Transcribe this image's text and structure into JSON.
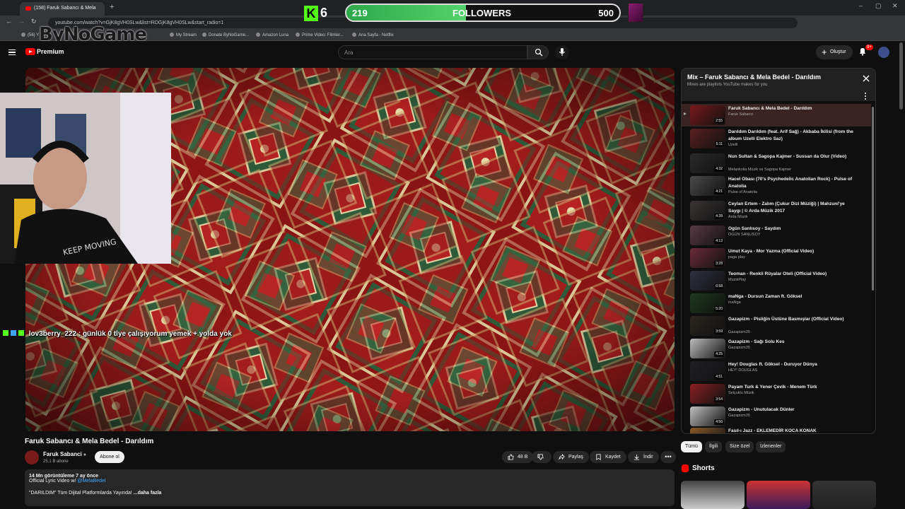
{
  "browser": {
    "tab_title": "(158) Faruk Sabancı & Mela",
    "url": "youtube.com/watch?v=GjK8gVH0SLw&list=RDGjK8gVH0SLw&start_radio=1",
    "bookmarks": [
      "(56) Y",
      "My Stream",
      "Donate ByNoGame...",
      "Amazon Luna",
      "Prime Video: Filmler...",
      "Ana Sayfa - Netflix"
    ]
  },
  "overlay": {
    "logo_text": "ByNoGame",
    "kick_count": "6",
    "followers_current": "219",
    "followers_label": "FOLLOWERS",
    "followers_goal": "500",
    "followers_progress": 0.438,
    "chat_message": "lov3berry_222 : günlük 0 tlye çalışıyorum yemek + yolda yok"
  },
  "header": {
    "premium_label": "Premium",
    "search_placeholder": "Ara",
    "create_label": "Oluştur",
    "notification_count": "9+"
  },
  "video": {
    "title": "Faruk Sabancı & Mela Bedel - Darıldım",
    "channel": "Faruk Sabanci",
    "subscribers": "25,1 B abone",
    "subscribe_label": "Abone ol",
    "likes": "48 B",
    "share_label": "Paylaş",
    "save_label": "Kaydet",
    "download_label": "İndir",
    "views_line": "14 Mn görüntüleme  7 ay önce",
    "desc_line1_prefix": "Official Lyric Video w/ ",
    "desc_link": "@MelaBedel",
    "desc_line3": "\"DARILDIM\" Tüm Dijital Platformlarda Yayında!",
    "more_label": "...daha fazla"
  },
  "playlist": {
    "title": "Mix – Faruk Sabancı & Mela Bedel - Darıldım",
    "subtitle": "Mixes are playlists YouTube makes for you",
    "items": [
      {
        "title": "Faruk Sabancı & Mela Bedel - Darıldım",
        "channel": "Faruk Sabanci",
        "duration": "2:55",
        "color": "#7a1a1a"
      },
      {
        "title": "Darıldım Darıldım (feat. Arif Sağ) - Akbaba İkilisi (from the album Uzelli Elektro Saz)",
        "channel": "Uzelli",
        "duration": "5:11",
        "color": "#5a2020"
      },
      {
        "title": "Nun Sultan & Sagopa Kajmer - Sussan da Olur (Video)",
        "channel": "Melankolia Müzik ve Sagopa Kajmer",
        "duration": "4:32",
        "color": "#2a2a2a"
      },
      {
        "title": "Hacel Obası (70's Psychedelic Anatolian Rock) - Pulse of Anatolia",
        "channel": "Pulse of Anatolia",
        "duration": "4:21",
        "color": "#4a4a4a"
      },
      {
        "title": "Ceylan Ertem - Zalım (Çukur Dizi Müziği) | Mahzuni'ye Saygı | © Arda Müzik 2017",
        "channel": "Arda Müzik",
        "duration": "4:28",
        "color": "#3a3535"
      },
      {
        "title": "Ogün Sanlısoy - Saydım",
        "channel": "OGÜN SANLISOY",
        "duration": "4:13",
        "color": "#5a3a45"
      },
      {
        "title": "Umut Kaya - Mor Yazma (Official Video)",
        "channel": "paga play",
        "duration": "3:28",
        "color": "#6a2a3a"
      },
      {
        "title": "Teoman - Renkli Rüyalar Oteli (Official Video)",
        "channel": "MuzikPlay",
        "duration": "6:58",
        "color": "#303040"
      },
      {
        "title": "maNga - Dursun Zaman ft. Göksel",
        "channel": "maNga",
        "duration": "5:20",
        "color": "#1e3a1e"
      },
      {
        "title": "Gazapizm - Pisliğin Üstüne Basmışlar (Official Video)",
        "channel": "Gazapizm35",
        "duration": "3:59",
        "color": "#2a2520"
      },
      {
        "title": "Gazapizm - Sağı Solu Kes",
        "channel": "Gazapizm35",
        "duration": "4:25",
        "color": "#bbbbbb"
      },
      {
        "title": "Hey! Douglas ft. Göksel - Duruyor Dünya",
        "channel": "HEY! DOUGLAS",
        "duration": "4:51",
        "color": "#202025"
      },
      {
        "title": "Payam Turk & Yener Çevik - Menem Türk",
        "channel": "Selçuklu Müzik",
        "duration": "3:54",
        "color": "#8a2020"
      },
      {
        "title": "Gazapizm - Unutulacak Dünler",
        "channel": "Gazapizm35",
        "duration": "4:56",
        "color": "#c0c0c0"
      },
      {
        "title": "Fasıl-ı Jazz - EKLEMEDİR KOCA KONAK",
        "channel": "",
        "duration": "",
        "color": "#8a5a2a"
      }
    ]
  },
  "chips": [
    "Tümü",
    "İlgili",
    "Size özel",
    "İzlenenler"
  ],
  "shorts_label": "Shorts",
  "colors": {
    "accent": "#ff0000",
    "kick": "#53fc18",
    "link": "#3ea6ff"
  }
}
